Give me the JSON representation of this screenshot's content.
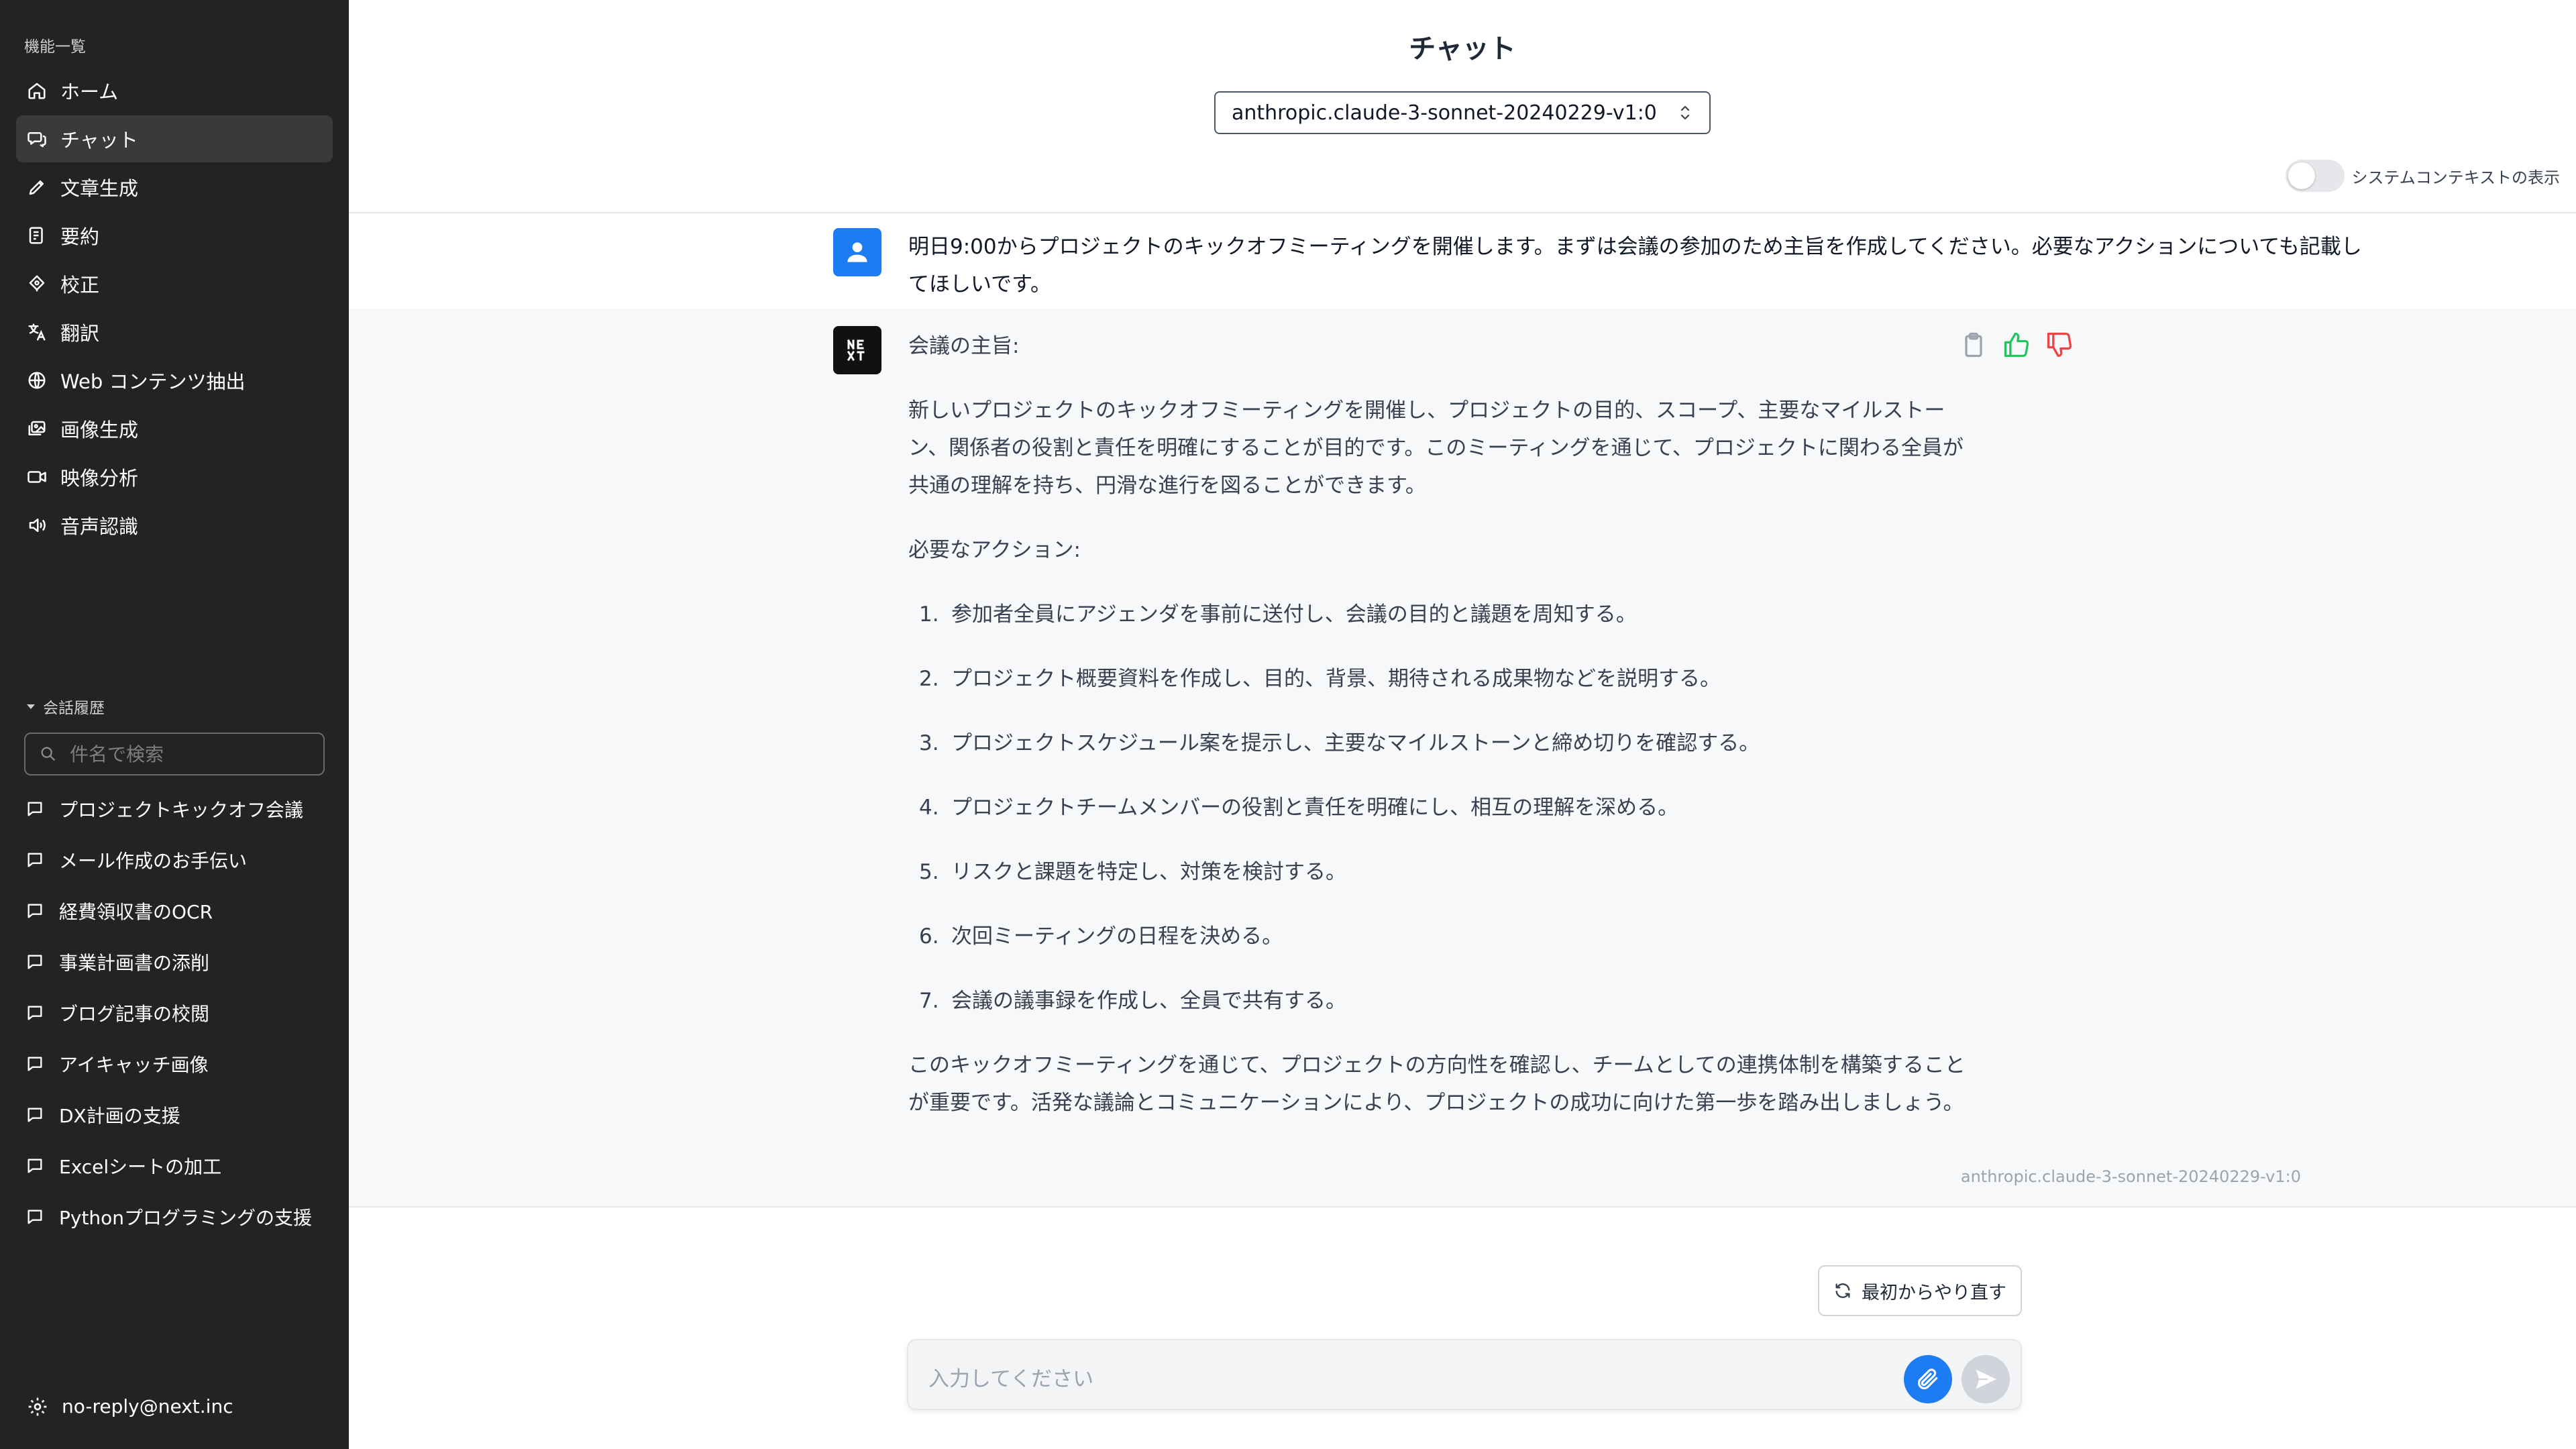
{
  "colors": {
    "sidebar_bg": "#232323",
    "sidebar_active": "#3a3a3a",
    "accent_blue": "#1d7cf2",
    "thumb_up_green": "#22c55e",
    "thumb_down_red": "#ef4444",
    "bot_bg": "#f7f8fa"
  },
  "sidebar": {
    "section_title": "機能一覧",
    "nav": [
      {
        "label": "ホーム",
        "icon": "home-icon"
      },
      {
        "label": "チャット",
        "icon": "chat-icon",
        "active": true
      },
      {
        "label": "文章生成",
        "icon": "pencil-icon"
      },
      {
        "label": "要約",
        "icon": "summary-icon"
      },
      {
        "label": "校正",
        "icon": "proofread-icon"
      },
      {
        "label": "翻訳",
        "icon": "translate-icon"
      },
      {
        "label": "Web コンテンツ抽出",
        "icon": "globe-icon"
      },
      {
        "label": "画像生成",
        "icon": "image-icon"
      },
      {
        "label": "映像分析",
        "icon": "video-icon"
      },
      {
        "label": "音声認識",
        "icon": "speaker-icon"
      }
    ],
    "history_title": "会話履歴",
    "search_placeholder": "件名で検索",
    "history": [
      "プロジェクトキックオフ会議",
      "メール作成のお手伝い",
      "経費領収書のOCR",
      "事業計画書の添削",
      "ブログ記事の校閲",
      "アイキャッチ画像",
      "DX計画の支援",
      "Excelシートの加工",
      "Pythonプログラミングの支援"
    ],
    "user_email": "no-reply@next.inc"
  },
  "main": {
    "title": "チャット",
    "model_selected": "anthropic.claude-3-sonnet-20240229-v1:0",
    "system_context_label": "システムコンテキストの表示"
  },
  "messages": {
    "user_text": "明日9:00からプロジェクトのキックオフミーティングを開催します。まずは会議の参加のため主旨を作成してください。必要なアクションについても記載してほしいです。",
    "bot": {
      "heading": "会議の主旨:",
      "paragraph1": "新しいプロジェクトのキックオフミーティングを開催し、プロジェクトの目的、スコープ、主要なマイルストーン、関係者の役割と責任を明確にすることが目的です。このミーティングを通じて、プロジェクトに関わる全員が共通の理解を持ち、円滑な進行を図ることができます。",
      "actions_heading": "必要なアクション:",
      "actions": [
        {
          "num": "1.",
          "text": "参加者全員にアジェンダを事前に送付し、会議の目的と議題を周知する。"
        },
        {
          "num": "2.",
          "text": "プロジェクト概要資料を作成し、目的、背景、期待される成果物などを説明する。"
        },
        {
          "num": "3.",
          "text": "プロジェクトスケジュール案を提示し、主要なマイルストーンと締め切りを確認する。"
        },
        {
          "num": "4.",
          "text": "プロジェクトチームメンバーの役割と責任を明確にし、相互の理解を深める。"
        },
        {
          "num": "5.",
          "text": "リスクと課題を特定し、対策を検討する。"
        },
        {
          "num": "6.",
          "text": "次回ミーティングの日程を決める。"
        },
        {
          "num": "7.",
          "text": "会議の議事録を作成し、全員で共有する。"
        }
      ],
      "closing": "このキックオフミーティングを通じて、プロジェクトの方向性を確認し、チームとしての連携体制を構築することが重要です。活発な議論とコミュニケーションにより、プロジェクトの成功に向けた第一歩を踏み出しましょう。",
      "model_tag": "anthropic.claude-3-sonnet-20240229-v1:0"
    }
  },
  "controls": {
    "retry_label": "最初からやり直す",
    "input_placeholder": "入力してください"
  }
}
